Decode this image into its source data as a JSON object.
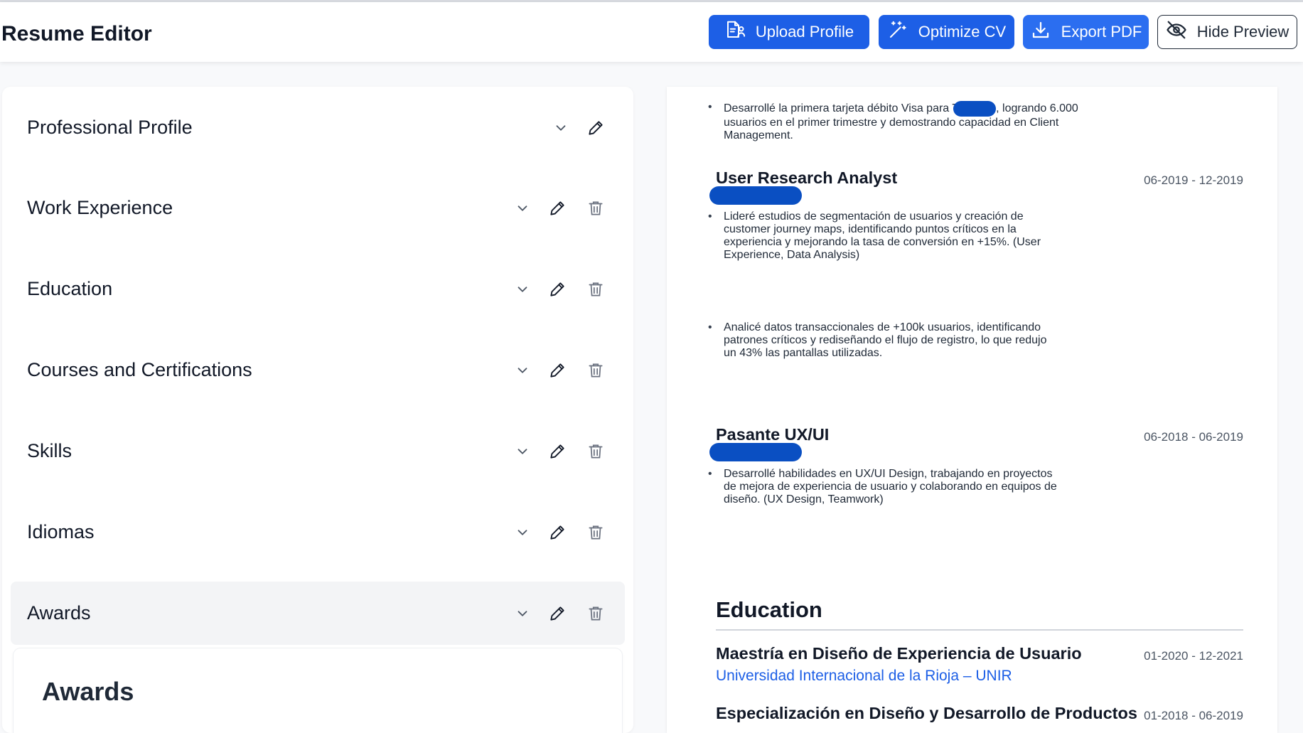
{
  "header": {
    "title": "Resume Editor",
    "buttons": {
      "upload": "Upload Profile",
      "optimize": "Optimize CV",
      "export": "Export PDF",
      "hide": "Hide Preview"
    }
  },
  "sections": [
    {
      "label": "Professional Profile",
      "deletable": false
    },
    {
      "label": "Work Experience",
      "deletable": true
    },
    {
      "label": "Education",
      "deletable": true
    },
    {
      "label": "Courses and Certifications",
      "deletable": true
    },
    {
      "label": "Skills",
      "deletable": true
    },
    {
      "label": "Idiomas",
      "deletable": true
    },
    {
      "label": "Awards",
      "deletable": true,
      "active": true
    }
  ],
  "awards_panel": {
    "heading": "Awards"
  },
  "preview": {
    "top_bullet_lines": [
      "Desarrollé la primera tarjeta débito Visa para T",
      ", logrando 6.000",
      "usuarios en el primer trimestre y demostrando capacidad en Client",
      "Management."
    ],
    "jobs": [
      {
        "title": "User Research Analyst",
        "date": "06-2019 - 12-2019",
        "bullets": [
          [
            "Lideré estudios de segmentación de usuarios y creación de",
            "customer journey maps, identificando puntos críticos en la",
            "experiencia y mejorando la tasa de conversión en +15%. (User",
            "Experience, Data Analysis)"
          ],
          [
            "Analicé datos transaccionales de +100k usuarios, identificando",
            "patrones críticos y rediseñando el flujo de registro, lo que redujo",
            "un 43% las pantallas utilizadas."
          ]
        ]
      },
      {
        "title": "Pasante UX/UI",
        "date": "06-2018 - 06-2019",
        "bullets": [
          [
            "Desarrollé habilidades en UX/UI Design, trabajando en proyectos",
            "de mejora de experiencia de usuario y colaborando en equipos de",
            "diseño. (UX Design, Teamwork)"
          ]
        ]
      }
    ],
    "education": {
      "heading": "Education",
      "items": [
        {
          "title": "Maestría en Diseño de Experiencia de Usuario",
          "date": "01-2020 - 12-2021",
          "institution": "Universidad Internacional de la Rioja – UNIR"
        },
        {
          "title": "Especialización en Diseño y Desarrollo de Productos",
          "date": "01-2018 - 06-2019",
          "institution": ""
        }
      ]
    }
  },
  "colors": {
    "primary": "#1d5fe6",
    "redaction": "#0a4fc2",
    "link": "#1d5fe6"
  },
  "icons": {
    "upload": "profile-document-icon",
    "optimize": "magic-wand-icon",
    "export": "download-icon",
    "hide": "eye-off-icon",
    "expand": "chevron-down-icon",
    "edit": "pencil-icon",
    "delete": "trash-icon"
  }
}
